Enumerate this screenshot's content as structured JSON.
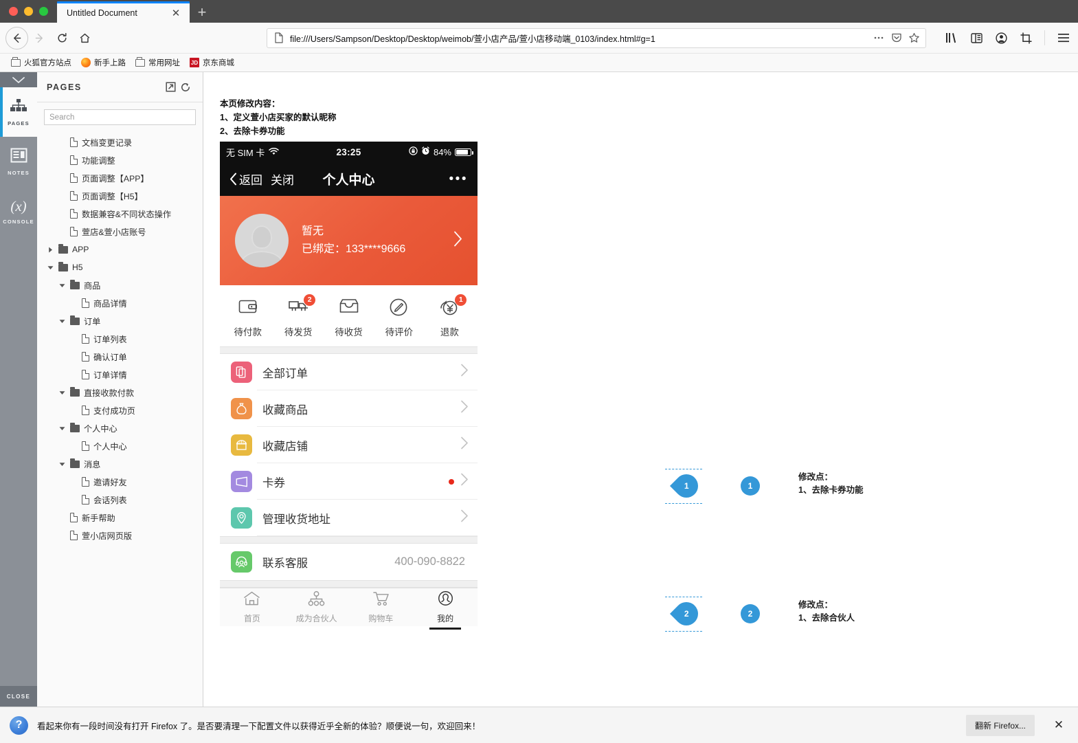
{
  "browser": {
    "tab": {
      "title": "Untitled Document",
      "close_label": "✕",
      "newtab_label": "+"
    },
    "url": "file:///Users/Sampson/Desktop/Desktop/weimob/萱小店产品/萱小店移动端_0103/index.html#g=1",
    "url_display": "file:///Users/Sampson/Desktop/Desktop/weimob/萱小店产品/萱小店移动端_0103/index.html#g=1",
    "bookmarks": [
      {
        "label": "火狐官方站点",
        "icon": "folder-icon"
      },
      {
        "label": "新手上路",
        "icon": "firefox-icon"
      },
      {
        "label": "常用网址",
        "icon": "folder-icon"
      },
      {
        "label": "京东商城",
        "icon": "jd-icon",
        "icon_text": "JD"
      }
    ]
  },
  "rail": {
    "collapse_icon": "chevron-down-icon",
    "items": [
      {
        "label": "PAGES",
        "icon": "sitemap-icon",
        "active": true
      },
      {
        "label": "NOTES",
        "icon": "notes-icon",
        "active": false
      },
      {
        "label": "CONSOLE",
        "icon": "console-icon",
        "active": false
      }
    ],
    "close_label": "CLOSE"
  },
  "pages_panel": {
    "title": "PAGES",
    "header_icons": [
      "external-link-icon",
      "refresh-icon"
    ],
    "search": {
      "placeholder": "Search",
      "value": ""
    },
    "tree": [
      {
        "label": "文档变更记录",
        "type": "page",
        "depth": 1
      },
      {
        "label": "功能调整",
        "type": "page",
        "depth": 1
      },
      {
        "label": "页面调整【APP】",
        "type": "page",
        "depth": 1
      },
      {
        "label": "页面调整【H5】",
        "type": "page",
        "depth": 1
      },
      {
        "label": "数据兼容&不同状态操作",
        "type": "page",
        "depth": 1
      },
      {
        "label": "萱店&萱小店账号",
        "type": "page",
        "depth": 1
      },
      {
        "label": "APP",
        "type": "folder",
        "depth": 0,
        "expanded": false
      },
      {
        "label": "H5",
        "type": "folder",
        "depth": 0,
        "expanded": true
      },
      {
        "label": "商品",
        "type": "folder",
        "depth": 1,
        "expanded": true
      },
      {
        "label": "商品详情",
        "type": "page",
        "depth": 2
      },
      {
        "label": "订单",
        "type": "folder",
        "depth": 1,
        "expanded": true
      },
      {
        "label": "订单列表",
        "type": "page",
        "depth": 2
      },
      {
        "label": "确认订单",
        "type": "page",
        "depth": 2
      },
      {
        "label": "订单详情",
        "type": "page",
        "depth": 2
      },
      {
        "label": "直接收款付款",
        "type": "folder",
        "depth": 1,
        "expanded": true
      },
      {
        "label": "支付成功页",
        "type": "page",
        "depth": 2
      },
      {
        "label": "个人中心",
        "type": "folder",
        "depth": 1,
        "expanded": true
      },
      {
        "label": "个人中心",
        "type": "page",
        "depth": 2
      },
      {
        "label": "消息",
        "type": "folder",
        "depth": 1,
        "expanded": true
      },
      {
        "label": "邀请好友",
        "type": "page",
        "depth": 2
      },
      {
        "label": "会话列表",
        "type": "page",
        "depth": 2
      },
      {
        "label": "新手帮助",
        "type": "page",
        "depth": 1
      },
      {
        "label": "萱小店网页版",
        "type": "page",
        "depth": 1
      }
    ]
  },
  "canvas": {
    "note": {
      "line1": "本页修改内容：",
      "line2": "1、定义萱小店买家的默认昵称",
      "line3": "2、去除卡券功能"
    },
    "phone": {
      "statusbar": {
        "carrier": "无 SIM 卡",
        "wifi_icon": "wifi-icon",
        "time": "23:25",
        "lock_icon": "rotation-lock-icon",
        "alarm_icon": "alarm-icon",
        "battery_pct": "84%"
      },
      "navhead": {
        "back": "返回",
        "close": "关闭",
        "title": "个人中心",
        "more": "•••"
      },
      "profile": {
        "nickname": "暂无",
        "bound_label": "已绑定：",
        "phone": "133****9666",
        "arrow": "›",
        "bg_color": "#ea5a3a"
      },
      "orders": [
        {
          "label": "待付款",
          "icon": "wallet-icon",
          "badge": ""
        },
        {
          "label": "待发货",
          "icon": "truck-icon",
          "badge": "2"
        },
        {
          "label": "待收货",
          "icon": "inbox-icon",
          "badge": ""
        },
        {
          "label": "待评价",
          "icon": "pencil-circle-icon",
          "badge": ""
        },
        {
          "label": "退款",
          "icon": "refund-yen-icon",
          "badge": "1"
        }
      ],
      "menu": [
        {
          "label": "全部订单",
          "icon": "documents-icon",
          "color": "#ec6179",
          "dot": false,
          "value": ""
        },
        {
          "label": "收藏商品",
          "icon": "bag-icon",
          "color": "#f0924a",
          "dot": false,
          "value": ""
        },
        {
          "label": "收藏店铺",
          "icon": "shop-icon",
          "color": "#e8b93f",
          "dot": false,
          "value": ""
        },
        {
          "label": "卡券",
          "icon": "coupon-icon",
          "color": "#a38ae0",
          "dot": true,
          "value": ""
        },
        {
          "label": "管理收货地址",
          "icon": "location-pin-icon",
          "color": "#5dc7ad",
          "dot": false,
          "value": ""
        }
      ],
      "service": {
        "label": "联系客服",
        "icon": "headset-icon",
        "color": "#66c96a",
        "phone": "400-090-8822"
      },
      "bottom_tabs": [
        {
          "label": "首页",
          "icon": "home-icon",
          "active": false
        },
        {
          "label": "成为合伙人",
          "icon": "partner-icon",
          "active": false
        },
        {
          "label": "购物车",
          "icon": "cart-icon",
          "active": false
        },
        {
          "label": "我的",
          "icon": "person-icon",
          "active": true
        }
      ]
    },
    "annotations": [
      {
        "num": "1",
        "title": "修改点：",
        "body": "1、去除卡券功能",
        "color": "#3498d8"
      },
      {
        "num": "2",
        "title": "修改点：",
        "body": "1、去除合伙人",
        "color": "#3498d8"
      }
    ]
  },
  "notification": {
    "icon": "question-icon",
    "message": "看起来你有一段时间没有打开 Firefox 了。是否要清理一下配置文件以获得近乎全新的体验？顺便说一句，欢迎回来！",
    "button": "翻新 Firefox...",
    "close": "✕"
  }
}
